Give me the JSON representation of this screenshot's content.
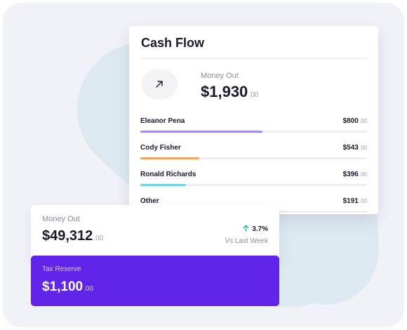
{
  "cash_flow": {
    "title": "Cash Flow",
    "icon": "arrow-up-right-icon",
    "summary_label": "Money Out",
    "summary_amount": "$1,930",
    "summary_cents": ".00",
    "rows": [
      {
        "name": "Eleanor Pena",
        "amount": "$800",
        "cents": ".00",
        "progress": 0.54,
        "color": "#a68bf0"
      },
      {
        "name": "Cody Fisher",
        "amount": "$543",
        "cents": ".00",
        "progress": 0.26,
        "color": "#f5a35c"
      },
      {
        "name": "Ronald Richards",
        "amount": "$396",
        "cents": ".00",
        "progress": 0.2,
        "color": "#6ad4e8"
      },
      {
        "name": "Other",
        "amount": "$191",
        "cents": ".00",
        "progress": 0.1,
        "color": "#f3a0b6"
      }
    ]
  },
  "money_out": {
    "label": "Money Out",
    "amount": "$49,312",
    "cents": ".00",
    "change": "3.7%",
    "change_icon": "arrow-up-icon",
    "change_color": "#2bbf8e",
    "comparison": "Vs Last Week"
  },
  "tax_reserve": {
    "label": "Tax Reserve",
    "amount": "$1,100",
    "cents": ".00",
    "background": "#6025e9"
  }
}
